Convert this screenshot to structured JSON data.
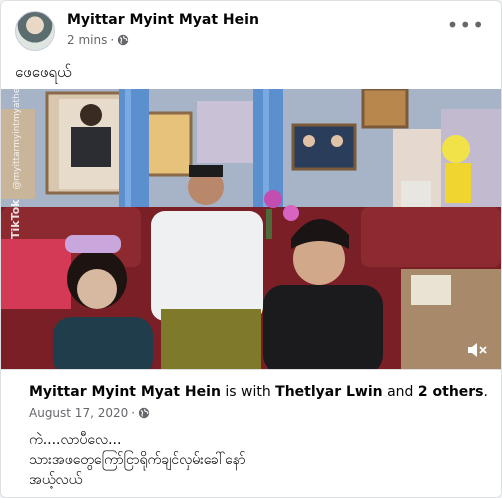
{
  "post": {
    "author": "Myittar Myint Myat Hein",
    "time": "2 mins",
    "privacy_icon": "globe-icon",
    "caption": "ဖေဖေရယ်"
  },
  "video": {
    "watermark": "TikTok",
    "handle": "@myittarmyintmyathein",
    "mute_icon": "speaker-muted-icon"
  },
  "shared": {
    "author": "Myittar Myint Myat Hein",
    "with_text": "is with",
    "tagged": "Thetlyar Lwin",
    "and_text": "and",
    "others": "2 others",
    "period": ".",
    "date": "August 17, 2020",
    "lines": [
      "ကဲ....လာပီလေ...",
      "သားအဖတွေကြော်ငြာရိုက်ချင်လှမ်းခေါ်နော်",
      "အယ့်လယ်"
    ]
  }
}
